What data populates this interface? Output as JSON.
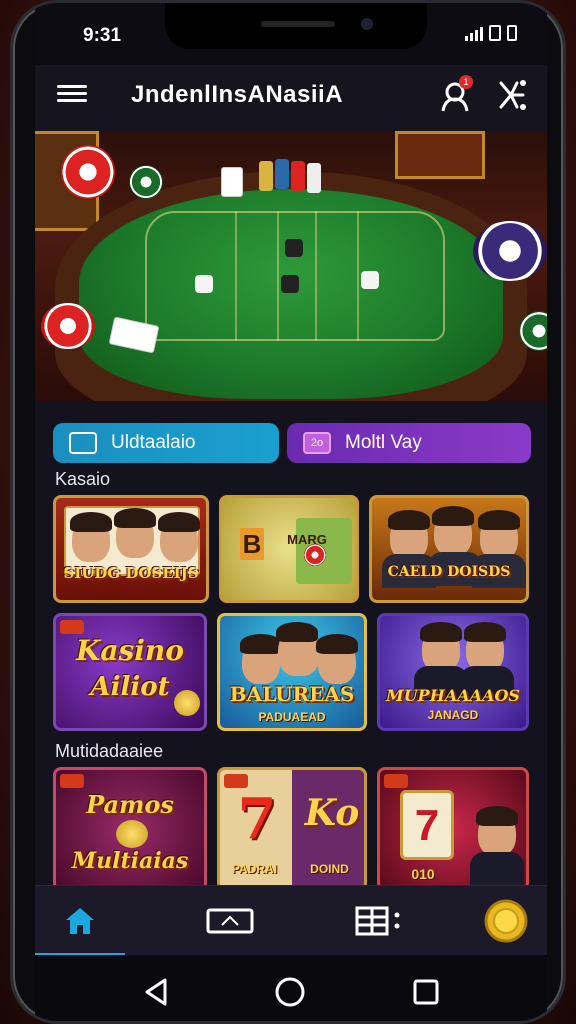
{
  "status_bar": {
    "time": "9:31"
  },
  "header": {
    "title": "JndenlInsANasiiA",
    "notification_count": "1"
  },
  "tabs": [
    {
      "label": "Uldtaalaio",
      "icon": "casino-icon"
    },
    {
      "label": "Moltl Vay",
      "icon_text": "2o",
      "icon": "mobile-icon"
    }
  ],
  "sections": [
    {
      "label": "Kasaio"
    },
    {
      "label": "Mutidadaaiee"
    }
  ],
  "games": {
    "row1": [
      {
        "title": "SIUDG DOSEIJS",
        "badge": ""
      },
      {
        "title": "B",
        "subtitle": "MARG",
        "badge": ""
      },
      {
        "title": "CAELD DOISDS",
        "badge": ""
      }
    ],
    "row2": [
      {
        "title": "Kasino",
        "subtitle": "Ailiot",
        "badge": ""
      },
      {
        "title": "BALUREAS",
        "subtitle": "PADUAEAD",
        "badge": ""
      },
      {
        "title": "MUPHAAAAOS",
        "subtitle": "JANAGD",
        "badge": ""
      }
    ],
    "row3": [
      {
        "title": "Pamos",
        "subtitle": "Multiaias",
        "badge": ""
      },
      {
        "title": "7",
        "title2": "Ko",
        "subtitle": "PADRAI",
        "subtitle2": "DOIND",
        "badge": ""
      },
      {
        "title": "7",
        "subtitle": "010",
        "badge": ""
      }
    ]
  },
  "bottom_nav": [
    "home-icon",
    "ticket-icon",
    "grid-menu-icon",
    "coin-icon"
  ],
  "colors": {
    "accent_blue": "#19a8e0",
    "accent_purple": "#8a3ac8",
    "gold": "#c89a3a"
  }
}
